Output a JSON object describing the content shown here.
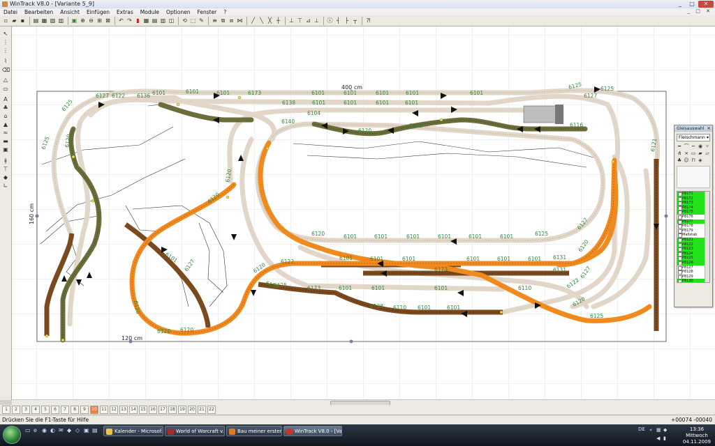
{
  "app": {
    "title": "WinTrack V8.0 - [Variante 5_9]",
    "window_buttons": [
      "_",
      "□",
      "✕"
    ]
  },
  "menu": {
    "items": [
      "Datei",
      "Bearbeiten",
      "Ansicht",
      "Einfügen",
      "Extras",
      "Module",
      "Optionen",
      "Fenster",
      "?"
    ],
    "mdi_controls": "_ □ ✕"
  },
  "canvas": {
    "width_label": "400 cm",
    "height_label": "160 cm",
    "bottom_label": "120 cm",
    "track_labels": [
      "6101",
      "6101",
      "6173",
      "6101",
      "6101",
      "6101",
      "6101",
      "6101",
      "6125",
      "6127",
      "6122",
      "6136",
      "6101",
      "6138",
      "6140",
      "6120",
      "6120",
      "6125",
      "6125",
      "6121",
      "6101",
      "6101",
      "6104",
      "6101",
      "6101",
      "6116",
      "6125",
      "6127",
      "6120",
      "6101",
      "6101",
      "6120",
      "6101",
      "6101",
      "6101",
      "6101",
      "6125",
      "6127",
      "6120",
      "6131",
      "6101",
      "6173",
      "6101",
      "6101",
      "6101",
      "6101",
      "6101",
      "6131",
      "6122",
      "6127",
      "6120",
      "6125",
      "6125",
      "6120",
      "6110",
      "6101",
      "6138",
      "6101",
      "6120",
      "6120",
      "6120",
      "6120",
      "6127",
      "6101",
      "6120",
      "6122",
      "6125",
      "6173",
      "6101",
      "6101",
      "6110",
      "6101"
    ]
  },
  "panel": {
    "title": "Gleisauswahl",
    "selected": "Fleischmann",
    "list": [
      "P8171",
      "P8172",
      "P8173",
      "P8174",
      "P8175",
      "P8176",
      "P8177",
      "P8178",
      "P8179",
      "Maßstab",
      "P8121",
      "P8122",
      "P8123",
      "P8124",
      "P8125",
      "P8126",
      "P8127",
      "P8128",
      "P8129",
      "P8130"
    ],
    "list_highlight": [
      true,
      true,
      true,
      true,
      true,
      false,
      true,
      false,
      false,
      false,
      true,
      true,
      true,
      true,
      true,
      true,
      false,
      false,
      false,
      true
    ]
  },
  "statusbar": {
    "hint": "Drücken Sie die F1-Taste für Hilfe",
    "coords": "+00074  -00040"
  },
  "taskbar": {
    "tasks": [
      "Kalender - Microsof...",
      "World of Warcraft v...",
      "Bau meiner ersten A...",
      "WinTrack V8.0 - [Va..."
    ],
    "lang": "DE",
    "time": "13:36",
    "day": "Mittwoch",
    "date": "04.11.2009"
  },
  "colors": {
    "orange_track": "#f08a1e",
    "brown_track": "#7a4a1e",
    "olive_track": "#6b6e3a",
    "light_track": "#e2d6c8",
    "label_green": "#2f8a3a"
  }
}
